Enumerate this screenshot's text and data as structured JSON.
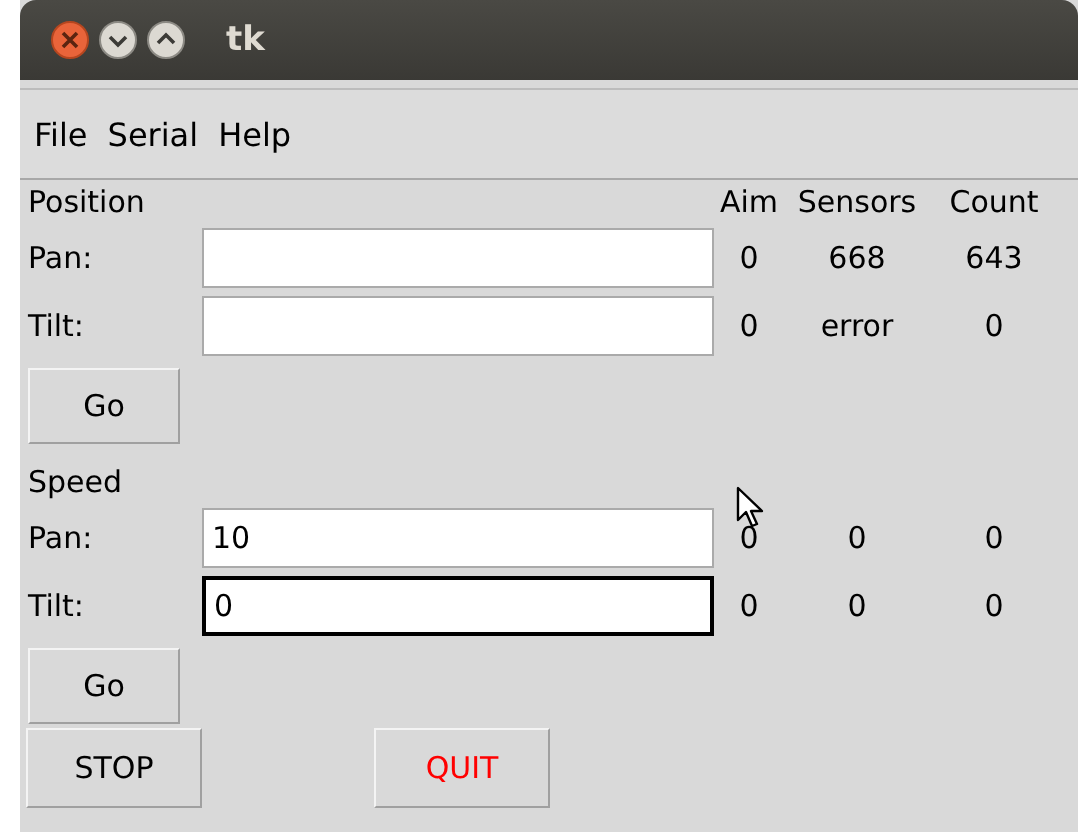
{
  "window": {
    "title": "tk"
  },
  "menu": [
    "File",
    "Serial",
    "Help"
  ],
  "position": {
    "title": "Position",
    "headers": [
      "Aim",
      "Sensors",
      "Count"
    ],
    "rows": [
      {
        "label": "Pan:",
        "focused": false,
        "aim": "0",
        "sensors": "668",
        "count": "643"
      },
      {
        "label": "Tilt:",
        "focused": false,
        "aim": "0",
        "sensors": "error",
        "count": "0"
      }
    ],
    "go": "Go"
  },
  "speed": {
    "title": "Speed",
    "rows": [
      {
        "label": "Pan:",
        "value": "10",
        "focused": false,
        "aim": "0",
        "sensors": "0",
        "count": "0"
      },
      {
        "label": "Tilt:",
        "value": "0",
        "focused": true,
        "aim": "0",
        "sensors": "0",
        "count": "0"
      }
    ],
    "go": "Go"
  },
  "buttons": [
    {
      "label": "STOP",
      "kind": "normal"
    },
    {
      "label": "QUIT",
      "kind": "danger"
    }
  ]
}
